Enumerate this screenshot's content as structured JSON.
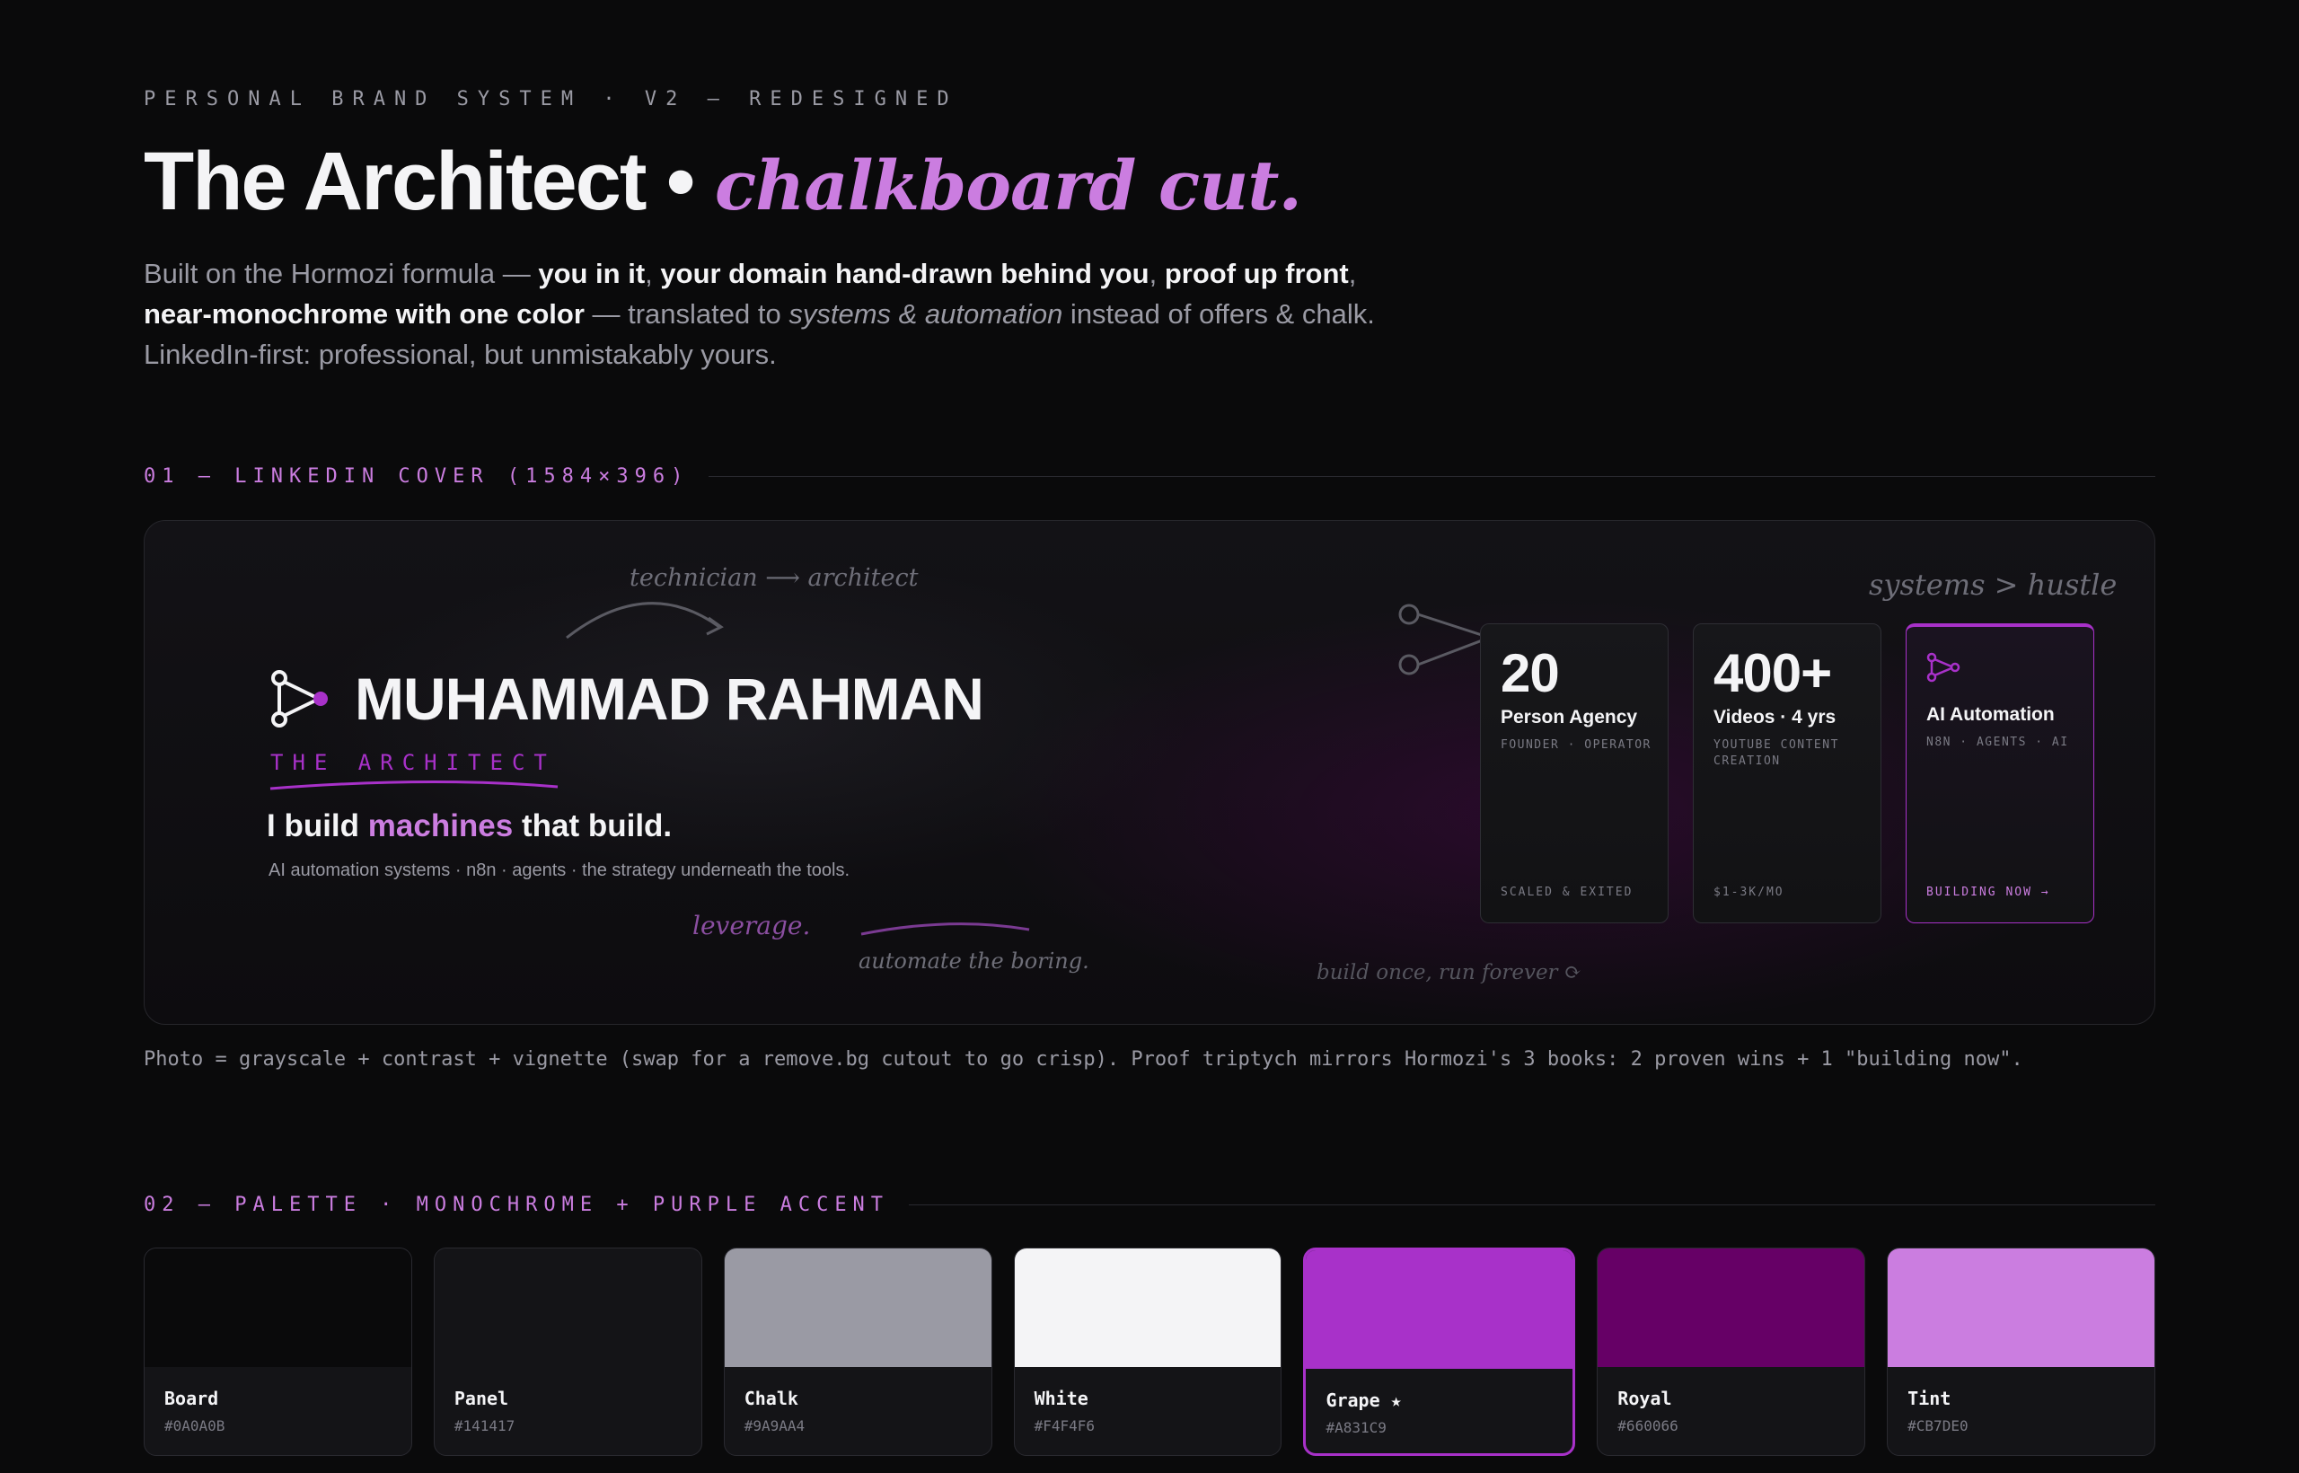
{
  "header": {
    "eyebrow": "PERSONAL BRAND SYSTEM · V2 — REDESIGNED",
    "title_main": "The Architect",
    "title_sep": " • ",
    "title_accent": "chalkboard cut.",
    "intro": {
      "p1": "Built on the Hormozi formula — ",
      "b1": "you in it",
      "c1": ", ",
      "b2": "your domain hand-drawn behind you",
      "c2": ", ",
      "b3": "proof up front",
      "c3": ",",
      "b4": "near-monochrome with one color",
      "p2": " — translated to ",
      "i1": "systems & automation",
      "p3": " instead of offers & chalk.",
      "p4": "LinkedIn-first: professional, but unmistakably yours."
    }
  },
  "section1": {
    "label": "01 — LINKEDIN COVER (1584×396)"
  },
  "cover": {
    "name": "MUHAMMAD RAHMAN",
    "role": "THE ARCHITECT",
    "tagline_a": "I build ",
    "tagline_hl": "machines",
    "tagline_b": " that build.",
    "subtag": "AI automation systems · n8n · agents · the strategy underneath the tools.",
    "notes": {
      "technician": "technician ⟶ architect",
      "systems": "systems > hustle",
      "leverage": "leverage.",
      "automate": "automate the boring.",
      "build_once": "build once, run forever ⟳"
    },
    "stats": [
      {
        "num": "20",
        "label": "Person Agency",
        "sub": "FOUNDER · OPERATOR",
        "foot": "SCALED & EXITED"
      },
      {
        "num": "400+",
        "label": "Videos · 4 yrs",
        "sub": "YOUTUBE CONTENT CREATION",
        "foot": "$1-3K/MO"
      },
      {
        "icon": "workflow-icon",
        "label": "AI Automation",
        "sub": "N8N · AGENTS · AI",
        "foot": "BUILDING NOW →"
      }
    ]
  },
  "caption": "Photo = grayscale + contrast + vignette (swap for a remove.bg cutout to go crisp). Proof triptych mirrors Hormozi's 3 books: 2 proven wins + 1 \"building now\".",
  "section2": {
    "label": "02 — PALETTE · MONOCHROME + PURPLE ACCENT"
  },
  "palette": [
    {
      "name": "Board",
      "hex": "#0A0A0B"
    },
    {
      "name": "Panel",
      "hex": "#141417"
    },
    {
      "name": "Chalk",
      "hex": "#9A9AA4"
    },
    {
      "name": "White",
      "hex": "#F4F4F6"
    },
    {
      "name": "Grape ★",
      "hex": "#A831C9"
    },
    {
      "name": "Royal",
      "hex": "#660066"
    },
    {
      "name": "Tint",
      "hex": "#CB7DE0"
    }
  ],
  "colors": {
    "accent": "#A831C9",
    "tint": "#CB7DE0"
  }
}
